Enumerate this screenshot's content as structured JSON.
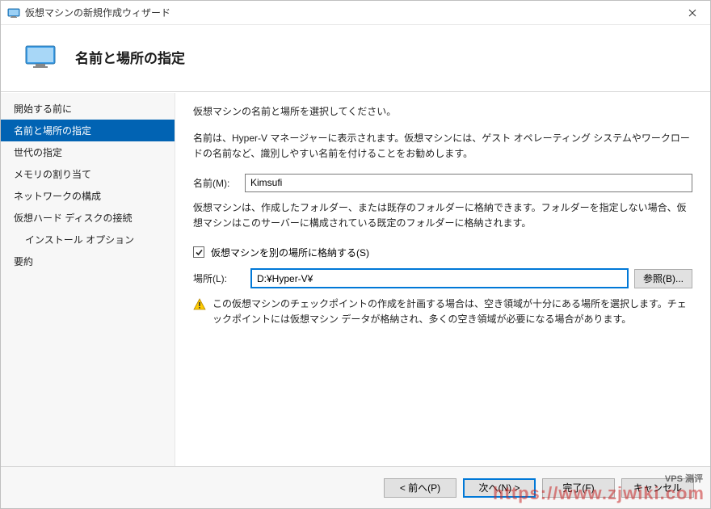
{
  "window": {
    "title": "仮想マシンの新規作成ウィザード"
  },
  "header": {
    "title": "名前と場所の指定"
  },
  "sidebar": {
    "items": [
      {
        "label": "開始する前に",
        "level": 1
      },
      {
        "label": "名前と場所の指定",
        "level": 1,
        "selected": true
      },
      {
        "label": "世代の指定",
        "level": 1
      },
      {
        "label": "メモリの割り当て",
        "level": 1
      },
      {
        "label": "ネットワークの構成",
        "level": 1
      },
      {
        "label": "仮想ハード ディスクの接続",
        "level": 1
      },
      {
        "label": "インストール オプション",
        "level": 2
      },
      {
        "label": "要約",
        "level": 1
      }
    ]
  },
  "main": {
    "intro": "仮想マシンの名前と場所を選択してください。",
    "name_help": "名前は、Hyper-V マネージャーに表示されます。仮想マシンには、ゲスト オペレーティング システムやワークロードの名前など、識別しやすい名前を付けることをお勧めします。",
    "name_label": "名前(M):",
    "name_value": "Kimsufi",
    "store_help": "仮想マシンは、作成したフォルダー、または既存のフォルダーに格納できます。フォルダーを指定しない場合、仮想マシンはこのサーバーに構成されている既定のフォルダーに格納されます。",
    "checkbox_label": "仮想マシンを別の場所に格納する(S)",
    "checkbox_checked": true,
    "location_label": "場所(L):",
    "location_value": "D:¥Hyper-V¥",
    "browse_label": "参照(B)...",
    "warning_text": "この仮想マシンのチェックポイントの作成を計画する場合は、空き領域が十分にある場所を選択します。チェックポイントには仮想マシン データが格納され、多くの空き領域が必要になる場合があります。"
  },
  "footer": {
    "back": "< 前へ(P)",
    "next": "次へ(N) >",
    "finish": "完了(F)",
    "cancel": "キャンセル"
  },
  "watermark": {
    "url": "https://www.zjwiki.com",
    "brand": "VPS 测评"
  }
}
